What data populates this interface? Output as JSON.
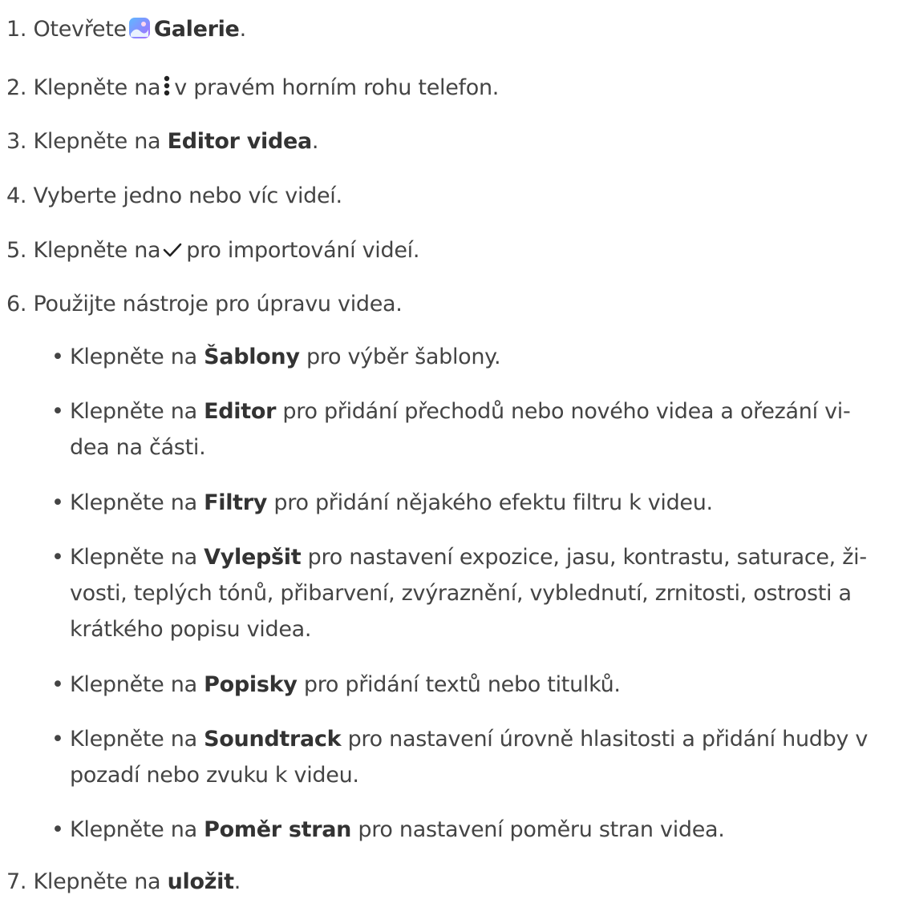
{
  "steps": [
    {
      "num": "1.",
      "pre": "Otevřete",
      "bold": "Galerie",
      "post": "."
    },
    {
      "num": "2.",
      "pre": "Klepněte na",
      "post": "v pravém horním rohu telefon."
    },
    {
      "num": "3.",
      "pre": "Klepněte na",
      "bold": "Editor videa",
      "post": "."
    },
    {
      "num": "4.",
      "text": "Vyberte jedno nebo víc videí."
    },
    {
      "num": "5.",
      "pre": "Klepněte na",
      "post": "pro importování videí."
    },
    {
      "num": "6.",
      "text": "Použijte nástroje pro úpravu videa."
    },
    {
      "num": "7.",
      "pre": "Klepněte na",
      "bold": "uložit",
      "post": "."
    }
  ],
  "bullets": [
    {
      "pre": "Klepněte na",
      "bold": "Šablony",
      "post": "pro výběr šablony."
    },
    {
      "pre": "Klepněte na",
      "bold": "Editor",
      "post": "pro přidání přechodů nebo nového videa a ořezání vi-",
      "cont": [
        "dea na části."
      ]
    },
    {
      "pre": "Klepněte na",
      "bold": "Filtry",
      "post": "pro přidání nějakého efektu filtru k videu."
    },
    {
      "pre": "Klepněte na",
      "bold": "Vylepšit",
      "post": "pro nastavení expozice, jasu, kontrastu, saturace, ži-",
      "cont": [
        "vosti, teplých tónů, přibarvení, zvýraznění, vyblednutí, zrnitosti, ostrosti a",
        "krátkého popisu videa."
      ]
    },
    {
      "pre": "Klepněte na",
      "bold": "Popisky",
      "post": "pro přidání textů nebo titulků."
    },
    {
      "pre": "Klepněte na",
      "bold": "Soundtrack",
      "post": "pro nastavení úrovně hlasitosti a přidání hudby v",
      "cont": [
        "pozadí nebo zvuku k videu."
      ]
    },
    {
      "pre": "Klepněte na",
      "bold": "Poměr stran",
      "post": "pro nastavení poměru stran videa."
    }
  ],
  "bullet_symbol": "•",
  "icons": {
    "gallery": "gallery-app-icon",
    "more": "vertical-dots-icon",
    "confirm": "checkmark-icon"
  },
  "colors": {
    "text": "#444444",
    "bold_text": "#333333",
    "gallery_icon_top": "#6aa8ff",
    "gallery_icon_bottom": "#a56bff"
  }
}
